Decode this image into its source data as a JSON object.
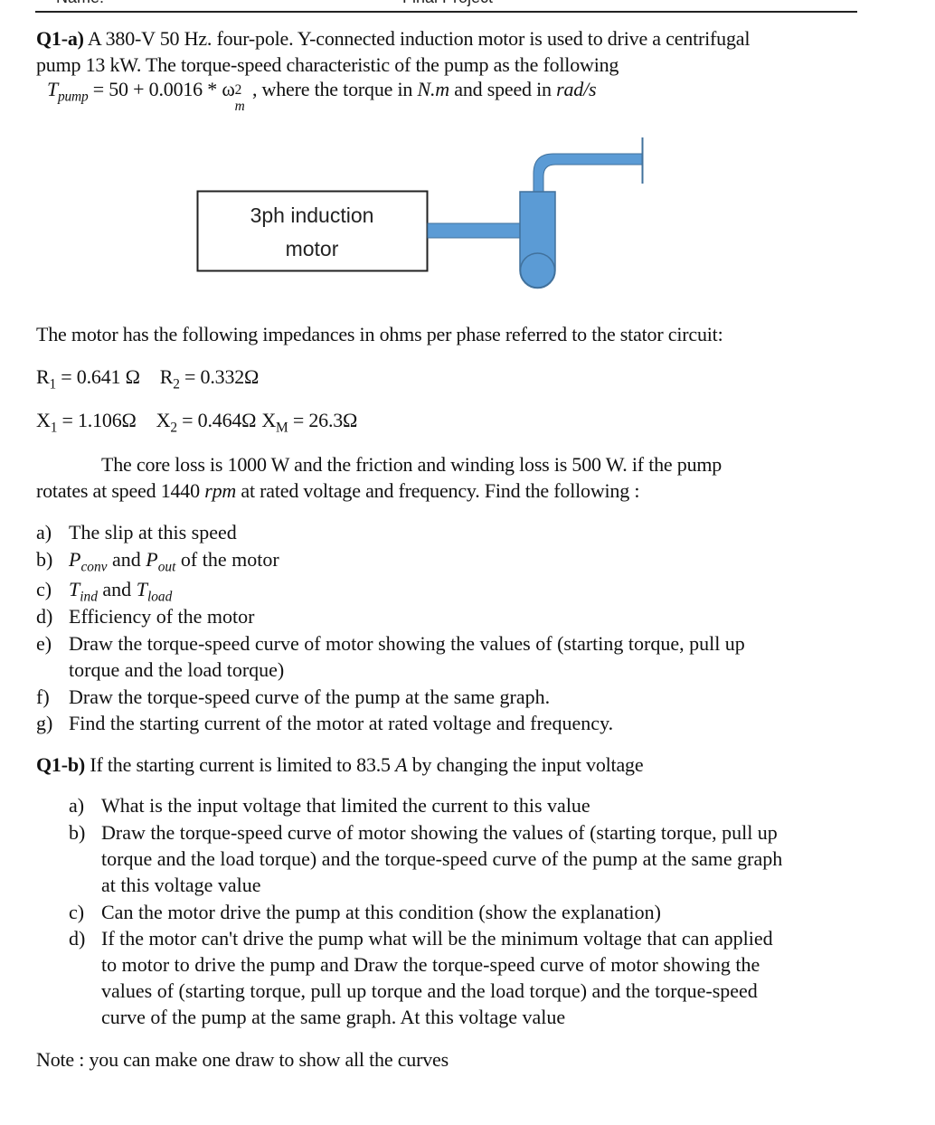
{
  "header": {
    "left": "Name:",
    "center": "Final Project"
  },
  "q1a": {
    "label": "Q1-a)",
    "intro_line1": " A 380-V 50 Hz. four-pole. Y-connected induction motor is used to drive a centrifugal",
    "intro_line2": "pump 13 kW. The torque-speed characteristic of the pump as the following",
    "eq": {
      "lhs": "T",
      "lhs_sub": "pump",
      "rhs": " = 50 + 0.0016 * ω",
      "rhs_sup": "2",
      "rhs_sub": "m",
      "tail_a": " , where the torque in ",
      "unit_torque": "N.m",
      "tail_b": " and speed in ",
      "unit_speed": "rad/s"
    },
    "diagram": {
      "motor_label_line1": "3ph induction",
      "motor_label_line2": "motor",
      "pump_color": "#5b9bd5",
      "pump_stroke": "#41719c"
    },
    "impedance_intro": "The motor has the following impedances in ohms per phase referred to the stator circuit:",
    "impedances": {
      "r1": {
        "sym": "R",
        "sub": "1",
        "val": " = 0.641 Ω"
      },
      "r2": {
        "sym": "R",
        "sub": "2",
        "val": " = 0.332Ω"
      },
      "x1": {
        "sym": "X",
        "sub": "1",
        "val": " = 1.106Ω"
      },
      "x2": {
        "sym": "X",
        "sub": "2",
        "val": " = 0.464Ω"
      },
      "xm": {
        "sym": "X",
        "sub": "M",
        "val": " = 26.3Ω"
      }
    },
    "loss_line1": "The core loss is 1000 W and the friction and winding loss is 500 W. if the pump",
    "loss_line2a": "rotates at speed 1440 ",
    "loss_rpm": "rpm",
    "loss_line2b": "  at rated voltage and frequency. Find the following :",
    "items": [
      {
        "label": "a)",
        "text": "The slip at this speed"
      },
      {
        "label": "b)",
        "p1": "P",
        "p1_sub": "conv",
        "mid": " and ",
        "p2": "P",
        "p2_sub": "out",
        "end": " of the motor"
      },
      {
        "label": "c)",
        "t1": "T",
        "t1_sub": "ind",
        "mid": " and ",
        "t2": "T",
        "t2_sub": "load"
      },
      {
        "label": "d)",
        "text": "Efficiency of the motor"
      },
      {
        "label": "e)",
        "text": "Draw the torque-speed curve of motor showing the values of  (starting torque, pull up",
        "text2": "torque and the load torque)"
      },
      {
        "label": "f)",
        "text": "Draw the torque-speed curve of the pump at the same graph."
      },
      {
        "label": "g)",
        "text": "Find the starting current of the motor at rated voltage and frequency."
      }
    ]
  },
  "q1b": {
    "label": "Q1-b)",
    "intro_a": " If the starting current is limited to 83.5 ",
    "intro_unit": "A",
    "intro_b": " by changing the input voltage",
    "items": [
      {
        "label": "a)",
        "lines": [
          "What is the input voltage that limited the current to this value"
        ]
      },
      {
        "label": "b)",
        "lines": [
          "Draw the torque-speed curve of motor showing the values of (starting torque, pull up",
          "torque and the load torque) and the torque-speed curve of the pump at the same graph",
          "at this voltage value"
        ]
      },
      {
        "label": "c)",
        "lines": [
          "Can the motor drive the pump at this condition (show the explanation)"
        ]
      },
      {
        "label": "d)",
        "lines": [
          "If the motor can't drive the pump what will be the minimum voltage that can applied",
          "to motor to drive the pump and Draw the torque-speed curve of motor showing the",
          "values of  (starting torque, pull up torque and the load torque) and the torque-speed",
          "curve of the pump at the same graph. At this voltage value"
        ]
      }
    ]
  },
  "note": "Note : you can make one draw to show all the curves"
}
